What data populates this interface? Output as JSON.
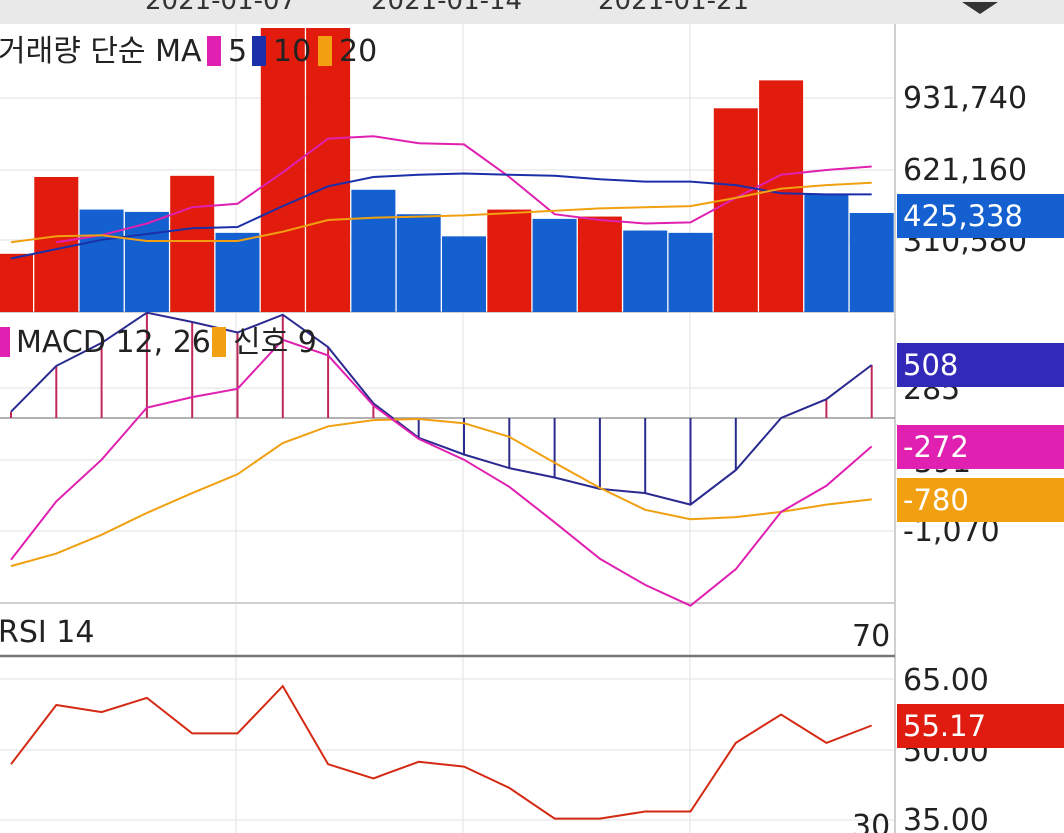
{
  "header": {
    "dates": [
      "2021-01-07",
      "2021-01-14",
      "2021-01-21"
    ]
  },
  "volume_panel": {
    "legend": {
      "title": "거래량 단순 MA",
      "ma": [
        {
          "label": "5",
          "color": "#e020b0"
        },
        {
          "label": "10",
          "color": "#1a2fa8"
        },
        {
          "label": "20",
          "color": "#f0a010"
        }
      ]
    },
    "axis_labels": [
      "931,740",
      "621,160",
      "310,580"
    ],
    "current_badge": {
      "text": "425,338",
      "color": "#1560d0"
    }
  },
  "macd_panel": {
    "legend": {
      "title": "MACD 12, 26",
      "signal_label": "신호 9",
      "macd_color": "#e020b0",
      "signal_color": "#f0a010"
    },
    "axis_labels": [
      "285",
      "-391",
      "-1,070"
    ],
    "badges": [
      {
        "text": "508",
        "color": "#3329b8"
      },
      {
        "text": "-272",
        "color": "#e020b0"
      },
      {
        "text": "-780",
        "color": "#f0a010"
      }
    ]
  },
  "rsi_panel": {
    "legend": {
      "title": "RSI 14"
    },
    "upper_level": "70",
    "lower_level": "30",
    "axis_labels": [
      "65.00",
      "50.00",
      "35.00"
    ],
    "current_badge": {
      "text": "55.17",
      "color": "#e01c10"
    }
  },
  "chart_data": [
    {
      "type": "bar",
      "title": "거래량 단순 MA",
      "y_ticks": [
        310580,
        621160,
        931740
      ],
      "ylim": [
        0,
        1220000
      ],
      "bars": [
        {
          "value": 250000,
          "color": "red"
        },
        {
          "value": 580000,
          "color": "red"
        },
        {
          "value": 440000,
          "color": "blue"
        },
        {
          "value": 430000,
          "color": "blue"
        },
        {
          "value": 585000,
          "color": "red"
        },
        {
          "value": 340000,
          "color": "blue"
        },
        {
          "value": 1220000,
          "color": "red"
        },
        {
          "value": 1220000,
          "color": "red"
        },
        {
          "value": 525000,
          "color": "blue"
        },
        {
          "value": 420000,
          "color": "blue"
        },
        {
          "value": 325000,
          "color": "blue"
        },
        {
          "value": 440000,
          "color": "red"
        },
        {
          "value": 400000,
          "color": "blue"
        },
        {
          "value": 410000,
          "color": "red"
        },
        {
          "value": 350000,
          "color": "blue"
        },
        {
          "value": 340000,
          "color": "blue"
        },
        {
          "value": 875000,
          "color": "red"
        },
        {
          "value": 995000,
          "color": "red"
        },
        {
          "value": 505000,
          "color": "blue"
        },
        {
          "value": 425338,
          "color": "blue"
        }
      ],
      "series": [
        {
          "name": "5",
          "values": [
            null,
            300000,
            330000,
            380000,
            450000,
            465000,
            600000,
            745000,
            755000,
            725000,
            720000,
            580000,
            420000,
            395000,
            380000,
            385000,
            490000,
            590000,
            610000,
            625000
          ]
        },
        {
          "name": "10",
          "values": [
            230000,
            270000,
            310000,
            335000,
            360000,
            365000,
            455000,
            540000,
            580000,
            590000,
            595000,
            590000,
            585000,
            570000,
            560000,
            560000,
            545000,
            510000,
            505000,
            505000
          ]
        },
        {
          "name": "20",
          "values": [
            300000,
            325000,
            330000,
            305000,
            305000,
            305000,
            345000,
            395000,
            405000,
            410000,
            415000,
            425000,
            435000,
            445000,
            450000,
            455000,
            490000,
            530000,
            545000,
            555000
          ]
        }
      ]
    },
    {
      "type": "line",
      "title": "MACD 12, 26",
      "y_ticks": [
        -1070,
        -391,
        285
      ],
      "series": [
        {
          "name": "MACD 12, 26",
          "values": [
            -1360,
            -800,
            -400,
            100,
            200,
            280,
            750,
            600,
            120,
            -200,
            -400,
            -660,
            -1000,
            -1350,
            -1600,
            -1800,
            -1450,
            -900,
            -650,
            -272
          ]
        },
        {
          "name": "신호 9",
          "values": [
            -1420,
            -1300,
            -1120,
            -910,
            -720,
            -540,
            -240,
            -80,
            -20,
            -10,
            -50,
            -180,
            -430,
            -670,
            -880,
            -970,
            -950,
            -900,
            -830,
            -780
          ]
        },
        {
          "name": "histogram",
          "values": [
            60,
            500,
            720,
            1010,
            920,
            820,
            990,
            680,
            140,
            -190,
            -350,
            -480,
            -570,
            -680,
            -720,
            -830,
            -500,
            0,
            180,
            508
          ]
        }
      ]
    },
    {
      "type": "line",
      "title": "RSI 14",
      "y_ticks": [
        35,
        50,
        65
      ],
      "reference_lines": [
        30,
        70
      ],
      "series": [
        {
          "name": "RSI 14",
          "values": [
            47,
            59.5,
            58,
            61,
            53.5,
            53.5,
            63.5,
            47,
            44,
            47.5,
            46.5,
            42,
            35.5,
            35.5,
            37,
            37,
            51.5,
            57.5,
            51.5,
            55.17
          ]
        }
      ]
    }
  ]
}
